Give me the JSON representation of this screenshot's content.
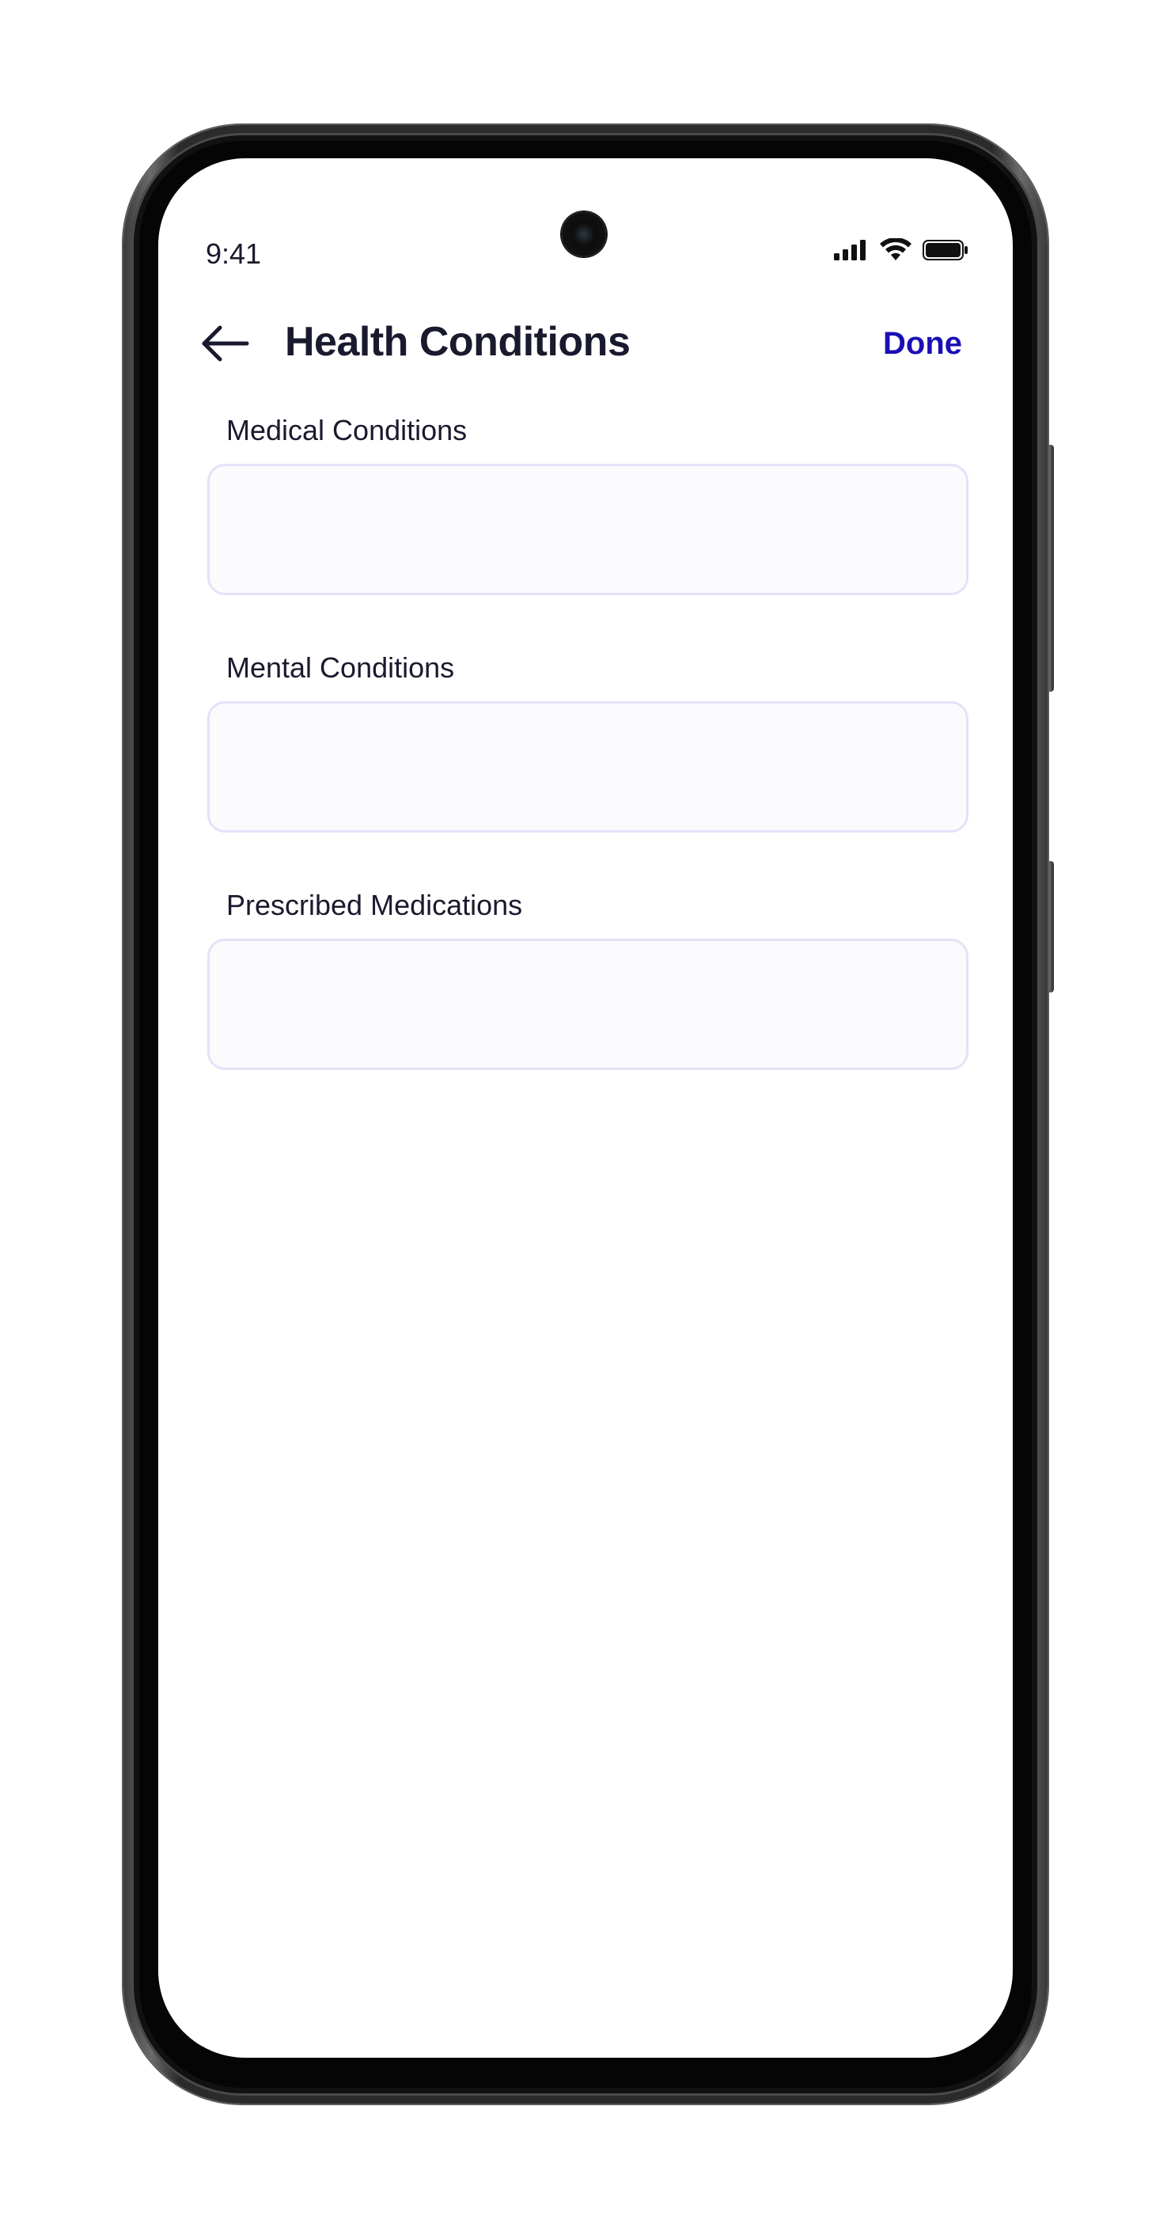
{
  "status_bar": {
    "time": "9:41",
    "icons": [
      "cellular-signal-icon",
      "wifi-icon",
      "battery-icon"
    ]
  },
  "header": {
    "back_icon": "arrow-left-icon",
    "title": "Health Conditions",
    "done_label": "Done"
  },
  "form": {
    "fields": [
      {
        "label": "Medical Conditions",
        "value": ""
      },
      {
        "label": "Mental Conditions",
        "value": ""
      },
      {
        "label": "Prescribed Medications",
        "value": ""
      }
    ]
  },
  "colors": {
    "text_primary": "#1a1a2e",
    "accent": "#1a0fb4",
    "field_border": "#e4e2f8",
    "field_bg": "#fbfbfe"
  }
}
